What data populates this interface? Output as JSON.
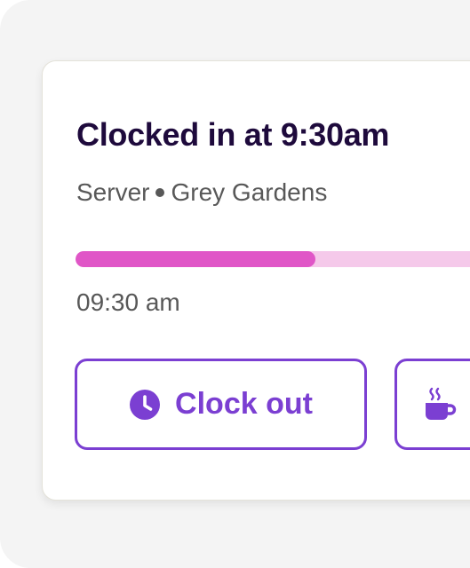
{
  "shift": {
    "title": "Clocked in at 9:30am",
    "role": "Server",
    "location": "Grey Gardens",
    "clock_in_time": "09:30 am",
    "progress_fraction": 0.52
  },
  "actions": {
    "clock_out_label": "Clock out",
    "clock_out_icon": "clock-icon",
    "break_icon": "coffee-cup-icon"
  },
  "colors": {
    "accent": "#7b3fd2",
    "title": "#1e0a3c",
    "muted_text": "#585858",
    "progress_fill": "#e056c7",
    "progress_track": "#f5c9ea"
  }
}
